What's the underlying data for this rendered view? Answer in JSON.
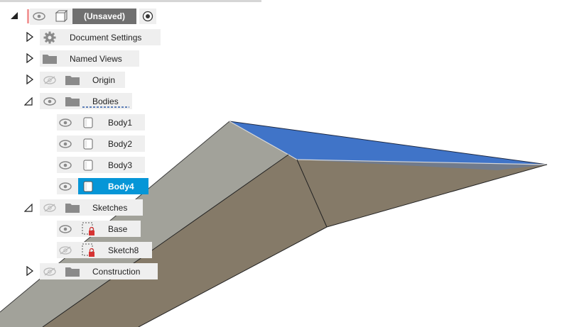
{
  "browser": {
    "root": {
      "label": "(Unsaved)"
    },
    "items": [
      {
        "label": "Document Settings"
      },
      {
        "label": "Named Views"
      },
      {
        "label": "Origin"
      },
      {
        "label": "Bodies"
      },
      {
        "label": "Body1"
      },
      {
        "label": "Body2"
      },
      {
        "label": "Body3"
      },
      {
        "label": "Body4"
      },
      {
        "label": "Sketches"
      },
      {
        "label": "Base"
      },
      {
        "label": "Sketch8"
      },
      {
        "label": "Construction"
      }
    ]
  },
  "colors": {
    "selection": "#0696d7",
    "body_face_top": "#3a6fc4",
    "body_face_side": "#857a68",
    "body_face_light": "#a2a29a",
    "sketch_lock": "#d63333"
  },
  "icons": {
    "visible": "eye-icon",
    "hidden": "eye-hidden-icon",
    "folder": "folder-icon",
    "settings": "gear-icon",
    "body": "body-icon",
    "sketch": "sketch-lock-icon",
    "component": "component-icon",
    "activate": "radio-activate-icon"
  }
}
